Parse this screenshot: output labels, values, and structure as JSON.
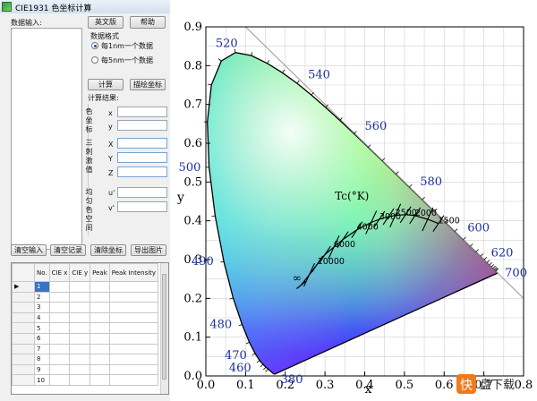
{
  "window": {
    "title": "CIE1931 色坐标计算"
  },
  "left": {
    "data_input_label": "数据输入:",
    "btn_english": "英文版",
    "btn_help": "帮助",
    "format_label": "数据格式",
    "radio1": "每1nm一个数据",
    "radio2": "每5nm一个数据",
    "btn_calc": "计算",
    "btn_draw": "描绘坐标",
    "result_label": "计算结果:",
    "group1": "色坐标",
    "group2": "三刺激值",
    "group3": "均匀色空间",
    "f_x": "x",
    "f_y": "y",
    "f_X": "X",
    "f_Y": "Y",
    "f_Z": "Z",
    "f_u": "u'",
    "f_v": "v'",
    "btn_clear_input": "清空输入",
    "btn_clear_record": "清空记录",
    "btn_clear_coord": "清除坐标",
    "btn_export": "导出图片"
  },
  "grid": {
    "columns": [
      "No.",
      "CIE x",
      "CIE y",
      "Peak",
      "Peak Intensity"
    ],
    "rows": [
      "1",
      "2",
      "3",
      "4",
      "5",
      "6",
      "7",
      "8",
      "9",
      "10"
    ]
  },
  "chart_data": {
    "type": "scatter",
    "xlabel": "x",
    "ylabel": "y",
    "xlim": [
      0.0,
      0.8
    ],
    "ylim": [
      0.0,
      0.9
    ],
    "xticks": [
      "0.0",
      "0.1",
      "0.2",
      "0.3",
      "0.4",
      "0.5",
      "0.6",
      "0.7",
      "0.8"
    ],
    "yticks": [
      "0.0",
      "0.1",
      "0.2",
      "0.3",
      "0.4",
      "0.5",
      "0.6",
      "0.7",
      "0.8",
      "0.9"
    ],
    "grid": true,
    "wavelength_labels": [
      {
        "nm": "380",
        "x": 0.175,
        "y": 0.005
      },
      {
        "nm": "460",
        "x": 0.144,
        "y": 0.03
      },
      {
        "nm": "470",
        "x": 0.124,
        "y": 0.058
      },
      {
        "nm": "480",
        "x": 0.091,
        "y": 0.133
      },
      {
        "nm": "490",
        "x": 0.045,
        "y": 0.295
      },
      {
        "nm": "500",
        "x": 0.008,
        "y": 0.538
      },
      {
        "nm": "520",
        "x": 0.074,
        "y": 0.834
      },
      {
        "nm": "540",
        "x": 0.23,
        "y": 0.754
      },
      {
        "nm": "560",
        "x": 0.373,
        "y": 0.625
      },
      {
        "nm": "580",
        "x": 0.512,
        "y": 0.487
      },
      {
        "nm": "600",
        "x": 0.627,
        "y": 0.373
      },
      {
        "nm": "620",
        "x": 0.691,
        "y": 0.308
      },
      {
        "nm": "700",
        "x": 0.735,
        "y": 0.265
      }
    ],
    "planck_title": "Tc(°K)",
    "cct_labels": [
      {
        "t": "10000",
        "x": 0.281,
        "y": 0.288
      },
      {
        "t": "6000",
        "x": 0.322,
        "y": 0.332
      },
      {
        "t": "4000",
        "x": 0.38,
        "y": 0.377
      },
      {
        "t": "3000",
        "x": 0.437,
        "y": 0.404
      },
      {
        "t": "2500",
        "x": 0.477,
        "y": 0.414
      },
      {
        "t": "2000",
        "x": 0.527,
        "y": 0.413
      },
      {
        "t": "1500",
        "x": 0.585,
        "y": 0.393
      }
    ],
    "infinity_label": "∞"
  },
  "watermark": {
    "text": "快",
    "text2": "盘下载"
  }
}
